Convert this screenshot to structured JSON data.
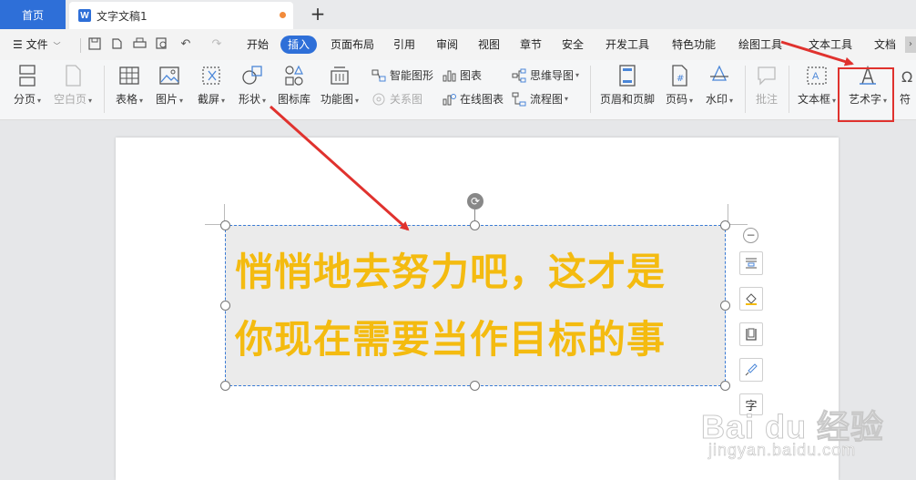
{
  "tabs": {
    "home_label": "首页",
    "doc_label": "文字文稿1",
    "doc_icon": "W"
  },
  "menu": {
    "file_label": "文件",
    "items": [
      "开始",
      "插入",
      "页面布局",
      "引用",
      "审阅",
      "视图",
      "章节",
      "安全",
      "开发工具",
      "特色功能",
      "绘图工具",
      "文本工具",
      "文档"
    ],
    "active_index": 1
  },
  "ribbon": {
    "page_break": "分页",
    "blank_page": "空白页",
    "table": "表格",
    "picture": "图片",
    "screenshot": "截屏",
    "shapes": "形状",
    "icon_library": "图标库",
    "function_chart": "功能图",
    "smart_shape": "智能图形",
    "relation_chart": "关系图",
    "chart": "图表",
    "online_chart": "在线图表",
    "mind_map": "思维导图",
    "flowchart": "流程图",
    "header_footer": "页眉和页脚",
    "page_number": "页码",
    "watermark": "水印",
    "comment": "批注",
    "text_box": "文本框",
    "word_art": "艺术字",
    "symbol": "符"
  },
  "document": {
    "art_text_line1": "悄悄地去努力吧，这才是",
    "art_text_line2": "你现在需要当作目标的事",
    "side_char": "字"
  },
  "watermark": {
    "main": "Bai du 经验",
    "sub": "jingyan.baidu.com"
  },
  "colors": {
    "accent": "#2e6fd8",
    "art_text": "#f4bb10",
    "annotation_red": "#e0322e"
  }
}
